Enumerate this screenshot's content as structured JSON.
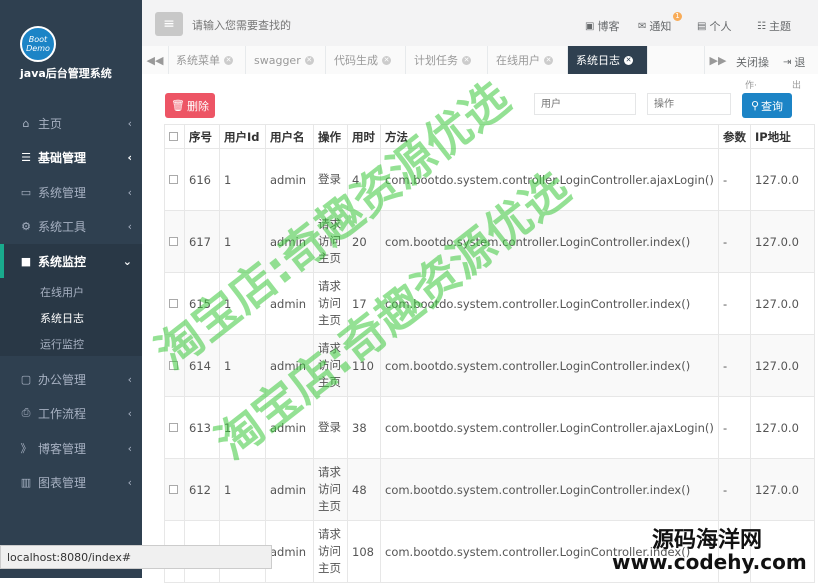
{
  "sidebar": {
    "logo_text": "Boot Demo",
    "app_title": "java后台管理系统",
    "items": [
      {
        "label": "主页",
        "icon": "home-icon"
      },
      {
        "label": "基础管理",
        "icon": "list-icon"
      },
      {
        "label": "系统管理",
        "icon": "desktop-icon"
      },
      {
        "label": "系统工具",
        "icon": "gear-icon"
      },
      {
        "label": "系统监控",
        "icon": "video-icon"
      },
      {
        "label": "办公管理",
        "icon": "laptop-icon"
      },
      {
        "label": "工作流程",
        "icon": "print-icon"
      },
      {
        "label": "博客管理",
        "icon": "rss-icon"
      },
      {
        "label": "图表管理",
        "icon": "bar-chart-icon"
      }
    ],
    "submenu": [
      "在线用户",
      "系统日志",
      "运行监控"
    ]
  },
  "topbar": {
    "search_placeholder": "请输入您需要查找的",
    "links": {
      "blog": "博客",
      "notify": "通知",
      "personal": "个人",
      "theme": "主题"
    },
    "notify_badge": "1"
  },
  "tabs": {
    "items": [
      "系统菜单",
      "swagger",
      "代码生成",
      "计划任务",
      "在线用户",
      "系统日志"
    ],
    "active": "系统日志",
    "close_label": "关闭操",
    "close_frag": "作·",
    "exit_label": "退",
    "exit_frag": "出"
  },
  "toolbar": {
    "delete_label": "删除",
    "user_placeholder": "用户",
    "action_placeholder": "操作",
    "query_label": "查询"
  },
  "table": {
    "headers": [
      "序号",
      "用户Id",
      "用户名",
      "操作",
      "用时",
      "方法",
      "参数",
      "IP地址"
    ],
    "rows": [
      {
        "id": "616",
        "uid": "1",
        "uname": "admin",
        "op": "登录",
        "time": "4",
        "method": "com.bootdo.system.controller.LoginController.ajaxLogin()",
        "params": "-",
        "ip": "127.0.0"
      },
      {
        "id": "617",
        "uid": "1",
        "uname": "admin",
        "op": "请求访问主页",
        "time": "20",
        "method": "com.bootdo.system.controller.LoginController.index()",
        "params": "-",
        "ip": "127.0.0"
      },
      {
        "id": "615",
        "uid": "1",
        "uname": "admin",
        "op": "请求访问主页",
        "time": "17",
        "method": "com.bootdo.system.controller.LoginController.index()",
        "params": "-",
        "ip": "127.0.0"
      },
      {
        "id": "614",
        "uid": "1",
        "uname": "admin",
        "op": "请求访问主页",
        "time": "110",
        "method": "com.bootdo.system.controller.LoginController.index()",
        "params": "-",
        "ip": "127.0.0"
      },
      {
        "id": "613",
        "uid": "1",
        "uname": "admin",
        "op": "登录",
        "time": "38",
        "method": "com.bootdo.system.controller.LoginController.ajaxLogin()",
        "params": "-",
        "ip": "127.0.0"
      },
      {
        "id": "612",
        "uid": "1",
        "uname": "admin",
        "op": "请求访问主页",
        "time": "48",
        "method": "com.bootdo.system.controller.LoginController.index()",
        "params": "-",
        "ip": "127.0.0"
      },
      {
        "id": "",
        "uid": "",
        "uname": "admin",
        "op": "请求访问主页",
        "time": "108",
        "method": "com.bootdo.system.controller.LoginController.index()",
        "params": "",
        "ip": ""
      }
    ]
  },
  "status_url": "localhost:8080/index#",
  "watermarks": {
    "line1": "淘宝店:奇趣资源优选",
    "line2": "淘宝店:奇趣资源优选",
    "site_name": "源码海洋网",
    "site_url": "www.codehy.com"
  }
}
